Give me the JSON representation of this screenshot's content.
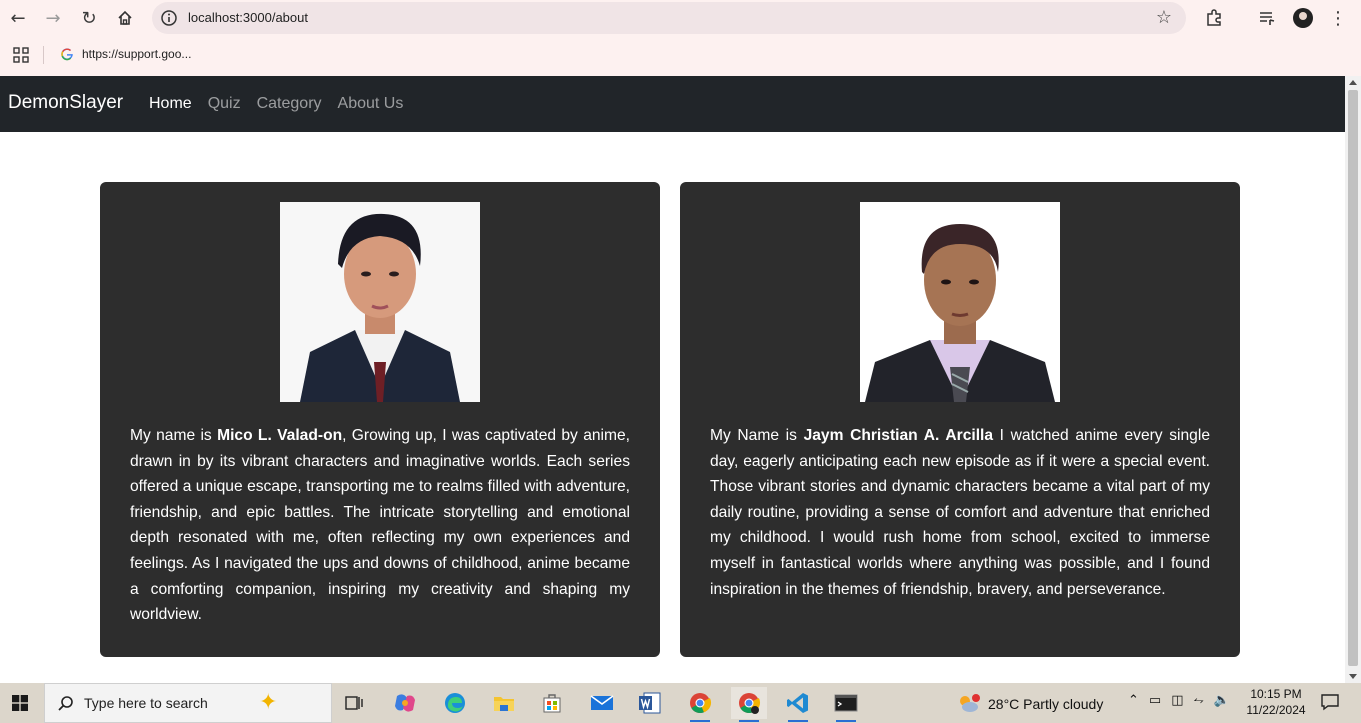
{
  "browser": {
    "url": "localhost:3000/about",
    "bookmark_label": "https://support.goo..."
  },
  "navbar": {
    "brand": "DemonSlayer",
    "links": [
      {
        "label": "Home"
      },
      {
        "label": "Quiz"
      },
      {
        "label": "Category"
      },
      {
        "label": "About Us"
      }
    ],
    "background": "#212529"
  },
  "cards": [
    {
      "intro": "My name is ",
      "name": "Mico L. Valad-on",
      "bio": ", Growing up, I was captivated by anime, drawn in by its vibrant characters and imaginative worlds. Each series offered a unique escape, transporting me to realms filled with adventure, friendship, and epic battles. The intricate storytelling and emotional depth resonated with me, often reflecting my own experiences and feelings. As I navigated the ups and downs of childhood, anime became a comforting companion, inspiring my creativity and shaping my worldview."
    },
    {
      "intro": "My Name is ",
      "name": "Jaym Christian A. Arcilla",
      "bio": " I watched anime every single day, eagerly anticipating each new episode as if it were a special event. Those vibrant stories and dynamic characters became a vital part of my daily routine, providing a sense of comfort and adventure that enriched my childhood. I would rush home from school, excited to immerse myself in fantastical worlds where anything was possible, and I found inspiration in the themes of friendship, bravery, and perseverance."
    }
  ],
  "taskbar": {
    "search_placeholder": "Type here to search",
    "weather": "28°C  Partly cloudy",
    "time": "10:15 PM",
    "date": "11/22/2024"
  }
}
